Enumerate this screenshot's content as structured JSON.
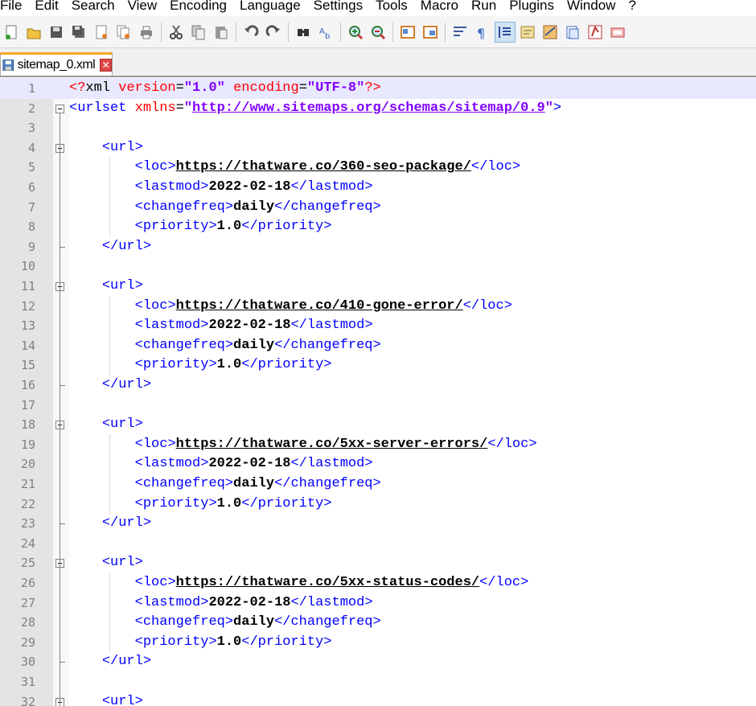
{
  "menu": [
    "File",
    "Edit",
    "Search",
    "View",
    "Encoding",
    "Language",
    "Settings",
    "Tools",
    "Macro",
    "Run",
    "Plugins",
    "Window",
    "?"
  ],
  "toolbar": {
    "buttons": [
      "new-file-icon",
      "open-file-icon",
      "save-icon",
      "save-all-icon",
      "close-icon",
      "close-all-icon",
      "print-icon",
      "cut-icon",
      "copy-icon",
      "paste-icon",
      "undo-icon",
      "redo-icon",
      "find-icon",
      "replace-icon",
      "zoom-in-icon",
      "zoom-out-icon",
      "sync-vertical-icon",
      "sync-horizontal-icon",
      "word-wrap-icon",
      "show-all-chars-icon",
      "indent-guide-icon",
      "udl-icon",
      "doc-map-icon",
      "function-list-icon",
      "folder-workspace-icon",
      "monitoring-icon"
    ]
  },
  "tab": {
    "filename": "sitemap_0.xml"
  },
  "editor": {
    "lines": [
      {
        "n": "1",
        "code": "<?xml version=\"1.0\" encoding=\"UTF-8\"?>"
      },
      {
        "n": "2",
        "code": "<urlset xmlns=\"http://www.sitemaps.org/schemas/sitemap/0.9\">"
      },
      {
        "n": "3",
        "code": ""
      },
      {
        "n": "4",
        "code": "    <url>"
      },
      {
        "n": "5",
        "code": "        <loc>https://thatware.co/360-seo-package/</loc>"
      },
      {
        "n": "6",
        "code": "        <lastmod>2022-02-18</lastmod>"
      },
      {
        "n": "7",
        "code": "        <changefreq>daily</changefreq>"
      },
      {
        "n": "8",
        "code": "        <priority>1.0</priority>"
      },
      {
        "n": "9",
        "code": "    </url>"
      },
      {
        "n": "10",
        "code": ""
      },
      {
        "n": "11",
        "code": "    <url>"
      },
      {
        "n": "12",
        "code": "        <loc>https://thatware.co/410-gone-error/</loc>"
      },
      {
        "n": "13",
        "code": "        <lastmod>2022-02-18</lastmod>"
      },
      {
        "n": "14",
        "code": "        <changefreq>daily</changefreq>"
      },
      {
        "n": "15",
        "code": "        <priority>1.0</priority>"
      },
      {
        "n": "16",
        "code": "    </url>"
      },
      {
        "n": "17",
        "code": ""
      },
      {
        "n": "18",
        "code": "    <url>"
      },
      {
        "n": "19",
        "code": "        <loc>https://thatware.co/5xx-server-errors/</loc>"
      },
      {
        "n": "20",
        "code": "        <lastmod>2022-02-18</lastmod>"
      },
      {
        "n": "21",
        "code": "        <changefreq>daily</changefreq>"
      },
      {
        "n": "22",
        "code": "        <priority>1.0</priority>"
      },
      {
        "n": "23",
        "code": "    </url>"
      },
      {
        "n": "24",
        "code": ""
      },
      {
        "n": "25",
        "code": "    <url>"
      },
      {
        "n": "26",
        "code": "        <loc>https://thatware.co/5xx-status-codes/</loc>"
      },
      {
        "n": "27",
        "code": "        <lastmod>2022-02-18</lastmod>"
      },
      {
        "n": "28",
        "code": "        <changefreq>daily</changefreq>"
      },
      {
        "n": "29",
        "code": "        <priority>1.0</priority>"
      },
      {
        "n": "30",
        "code": "    </url>"
      },
      {
        "n": "31",
        "code": ""
      },
      {
        "n": "32",
        "code": "    <url>"
      }
    ]
  },
  "colors": {
    "tag": "#0000ff",
    "attribute": "#ff0000",
    "attribute_value": "#8000ff",
    "current_line": "#e8e8ff",
    "active_tab_accent": "#f5a623"
  }
}
